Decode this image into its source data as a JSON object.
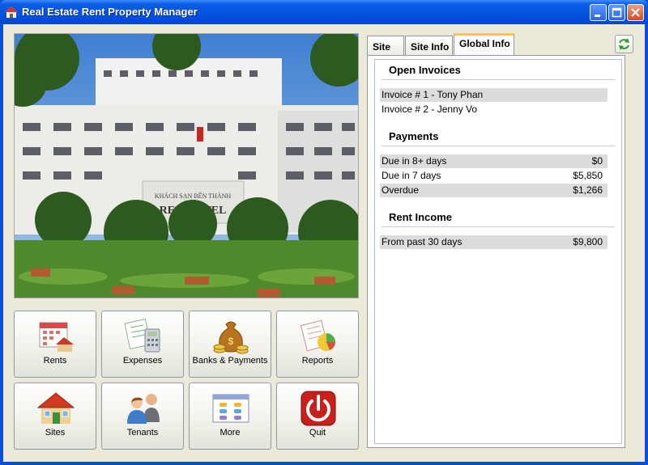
{
  "window": {
    "title": "Real Estate Rent Property Manager"
  },
  "buttons": [
    {
      "label": "Rents",
      "icon": "calendar-house-icon"
    },
    {
      "label": "Expenses",
      "icon": "receipt-calculator-icon"
    },
    {
      "label": "Banks & Payments",
      "icon": "money-bag-icon"
    },
    {
      "label": "Reports",
      "icon": "report-chart-icon"
    },
    {
      "label": "Sites",
      "icon": "house-icon"
    },
    {
      "label": "Tenants",
      "icon": "people-icon"
    },
    {
      "label": "More",
      "icon": "window-list-icon"
    },
    {
      "label": "Quit",
      "icon": "power-icon"
    }
  ],
  "tabs": [
    {
      "label": "Site"
    },
    {
      "label": "Site Info"
    },
    {
      "label": "Global Info",
      "active": true
    }
  ],
  "global_info": {
    "open_invoices": {
      "title": "Open Invoices",
      "items": [
        "Invoice # 1 - Tony Phan",
        "Invoice # 2 - Jenny Vo"
      ]
    },
    "payments": {
      "title": "Payments",
      "rows": [
        {
          "label": "Due in 8+ days",
          "value": "$0"
        },
        {
          "label": "Due in 7 days",
          "value": "$5,850"
        },
        {
          "label": "Overdue",
          "value": "$1,266"
        }
      ]
    },
    "rent_income": {
      "title": "Rent Income",
      "rows": [
        {
          "label": "From past 30 days",
          "value": "$9,800"
        }
      ]
    }
  },
  "photo": {
    "sign_line1": "KHÁCH SẠN BẾN THÀNH",
    "sign_line2": "REX HOTEL"
  },
  "colors": {
    "title_bar": "#0152dd",
    "client_bg": "#ece9d8",
    "active_tab_accent": "#ffc83c",
    "row_shade": "#dcdcdc"
  }
}
